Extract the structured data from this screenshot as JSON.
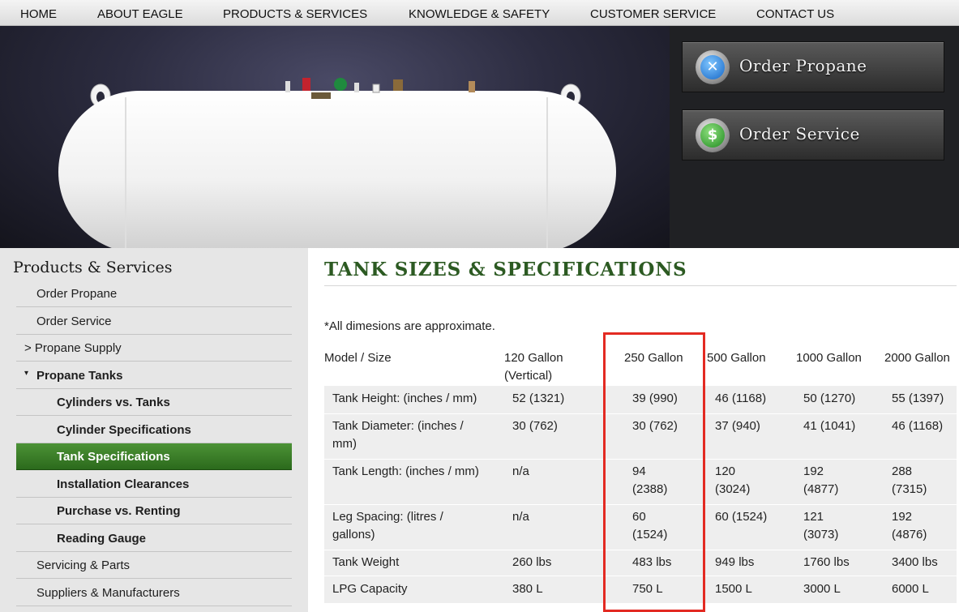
{
  "nav": {
    "items": [
      "HOME",
      "ABOUT EAGLE",
      "PRODUCTS & SERVICES",
      "KNOWLEDGE & SAFETY",
      "CUSTOMER SERVICE",
      "CONTACT US"
    ]
  },
  "hero": {
    "image": "white horizontal propane tank",
    "order_propane": {
      "label": "Order Propane",
      "icon": "tools-icon"
    },
    "order_service": {
      "label": "Order Service",
      "icon": "dollar-icon"
    }
  },
  "sidebar": {
    "title": "Products & Services",
    "items": [
      {
        "label": "Order Propane"
      },
      {
        "label": "Order Service"
      },
      {
        "label": "> Propane Supply"
      },
      {
        "label": "Propane Tanks",
        "expanded": true
      },
      {
        "label": "Cylinders vs. Tanks"
      },
      {
        "label": "Cylinder Specifications"
      },
      {
        "label": "Tank Specifications",
        "active": true
      },
      {
        "label": "Installation Clearances"
      },
      {
        "label": "Purchase vs. Renting"
      },
      {
        "label": "Reading Gauge"
      },
      {
        "label": "Servicing & Parts"
      },
      {
        "label": "Suppliers & Manufacturers"
      }
    ]
  },
  "content": {
    "title": "TANK SIZES & SPECIFICATIONS",
    "note": "*All dimesions are approximate.",
    "table": {
      "headers": [
        "Model / Size",
        "120 Gallon (Vertical)",
        "250 Gallon",
        "500 Gallon",
        "1000 Gallon",
        "2000 Gallon"
      ],
      "rows": [
        [
          "Tank Height: (inches / mm)",
          "52 (1321)",
          "39 (990)",
          "46 (1168)",
          "50 (1270)",
          "55 (1397)"
        ],
        [
          "Tank Diameter: (inches / mm)",
          "30 (762)",
          "30 (762)",
          "37 (940)",
          "41 (1041)",
          "46 (1168)"
        ],
        [
          "Tank Length: (inches / mm)",
          "n/a",
          "94 (2388)",
          "120 (3024)",
          "192 (4877)",
          "288 (7315)"
        ],
        [
          "Leg Spacing: (litres / gallons)",
          "n/a",
          "60 (1524)",
          "60 (1524)",
          "121 (3073)",
          "192 (4876)"
        ],
        [
          "Tank Weight",
          "260 lbs",
          "483 lbs",
          "949 lbs",
          "1760 lbs",
          "3400 lbs"
        ],
        [
          "LPG Capacity",
          "380 L",
          "750 L",
          "1500 L",
          "3000 L",
          "6000 L"
        ]
      ]
    },
    "highlight": {
      "column": "250 Gallon",
      "color": "#e32a22"
    }
  },
  "colors": {
    "accent_green": "#2c5a22",
    "active_item": "#3f8030",
    "highlight_red": "#e32a22"
  }
}
